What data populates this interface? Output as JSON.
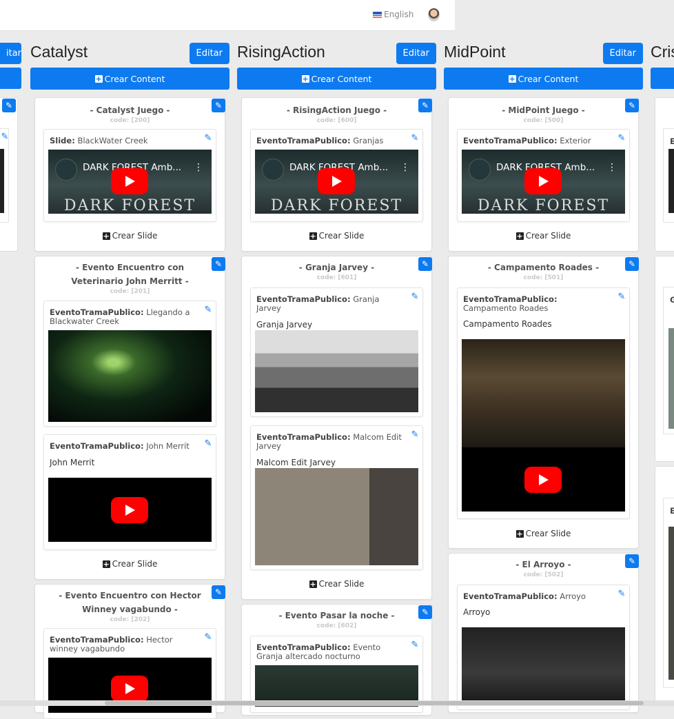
{
  "header": {
    "language": "English"
  },
  "columns": [
    {
      "title": "Catalyst",
      "edit_label": "Editar",
      "create_label": "Crear Content",
      "events": [
        {
          "title": "- Catalyst Juego -",
          "code": "code: [200]",
          "slide_create": "Crear Slide",
          "slides": [
            {
              "type": "Slide:",
              "name": "BlackWater Creek",
              "body": "",
              "media": "youtube",
              "video_title": "DARK FOREST Amb...",
              "video_overlay": "DARK FOREST"
            }
          ]
        },
        {
          "title": "- Evento Encuentro con Veterinario John Merritt -",
          "code": "code: [201]",
          "slide_create": "Crear Slide",
          "slides": [
            {
              "type": "EventoTramaPublico:",
              "name": "Llegando a Blackwater Creek",
              "body": "",
              "media": "image"
            },
            {
              "type": "EventoTramaPublico:",
              "name": "John Merrit",
              "body": "John Merrit",
              "media": "youtube"
            }
          ]
        },
        {
          "title": "- Evento Encuentro con Hector Winney vagabundo -",
          "code": "code: [202]",
          "slides": [
            {
              "type": "EventoTramaPublico:",
              "name": "Hector winney vagabundo",
              "body": "",
              "media": "youtube"
            }
          ]
        }
      ]
    },
    {
      "title": "RisingAction",
      "edit_label": "Editar",
      "create_label": "Crear Content",
      "events": [
        {
          "title": "- RisingAction Juego -",
          "code": "code: [600]",
          "slide_create": "Crear Slide",
          "slides": [
            {
              "type": "EventoTramaPublico:",
              "name": "Granjas",
              "body": "",
              "media": "youtube",
              "video_title": "DARK FOREST Amb...",
              "video_overlay": "DARK FOREST"
            }
          ]
        },
        {
          "title": "- Granja Jarvey -",
          "code": "code: [601]",
          "slide_create": "Crear Slide",
          "slides": [
            {
              "type": "EventoTramaPublico:",
              "name": "Granja Jarvey",
              "body": "Granja Jarvey",
              "media": "image"
            },
            {
              "type": "EventoTramaPublico:",
              "name": "Malcom Edit Jarvey",
              "body": "Malcom Edit Jarvey",
              "media": "image"
            }
          ]
        },
        {
          "title": "- Evento Pasar la noche -",
          "code": "code: [602]",
          "slides": [
            {
              "type": "EventoTramaPublico:",
              "name": "Evento Granja altercado nocturno",
              "body": "",
              "media": "image"
            }
          ]
        }
      ]
    },
    {
      "title": "MidPoint",
      "edit_label": "Editar",
      "create_label": "Crear Content",
      "events": [
        {
          "title": "- MidPoint Juego -",
          "code": "code: [500]",
          "slide_create": "Crear Slide",
          "slides": [
            {
              "type": "EventoTramaPublico:",
              "name": "Exterior",
              "body": "",
              "media": "youtube",
              "video_title": "DARK FOREST Amb...",
              "video_overlay": "DARK FOREST"
            }
          ]
        },
        {
          "title": "- Campamento Roades -",
          "code": "code: [501]",
          "slide_create": "Crear Slide",
          "slides": [
            {
              "type": "EventoTramaPublico:",
              "name": "Campamento Roades",
              "body": "Campamento Roades",
              "media": "image+youtube"
            }
          ]
        },
        {
          "title": "- El Arroyo -",
          "code": "code: [502]",
          "slides": [
            {
              "type": "EventoTramaPublico:",
              "name": "Arroyo",
              "body": "Arroyo",
              "media": "image"
            }
          ]
        }
      ]
    }
  ],
  "partial": {
    "left_edit": "itar",
    "right_title": "Cris",
    "right_letters": [
      "E",
      "G",
      "E",
      "C"
    ]
  }
}
